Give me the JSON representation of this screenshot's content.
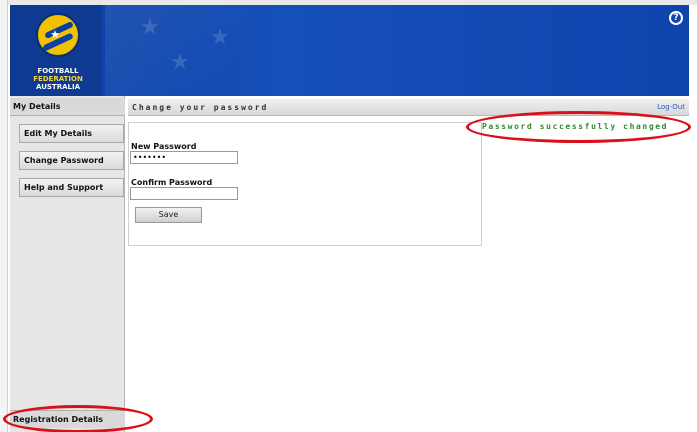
{
  "banner": {
    "logo_line1": "FOOTBALL",
    "logo_line2": "FEDERATION",
    "logo_line3": "AUSTRALIA",
    "help_icon": "?"
  },
  "sidebar": {
    "header": "My Details",
    "items": [
      {
        "label": "Edit My Details"
      },
      {
        "label": "Change Password"
      },
      {
        "label": "Help and Support"
      }
    ],
    "footer": "Registration Details"
  },
  "main": {
    "title": "Change your password",
    "logout": "Log-Out",
    "success_message": "Password successfully changed"
  },
  "form": {
    "new_password_label": "New Password",
    "new_password_value": "•••••••",
    "confirm_password_label": "Confirm Password",
    "confirm_password_value": "",
    "save_label": "Save"
  },
  "colors": {
    "banner_blue": "#1550b8",
    "success_green": "#2e8b2e",
    "annotation_red": "#d8101a",
    "logo_gold": "#f2c200"
  },
  "icons": {
    "help": "help-icon",
    "logo": "ffa-logo-icon"
  }
}
